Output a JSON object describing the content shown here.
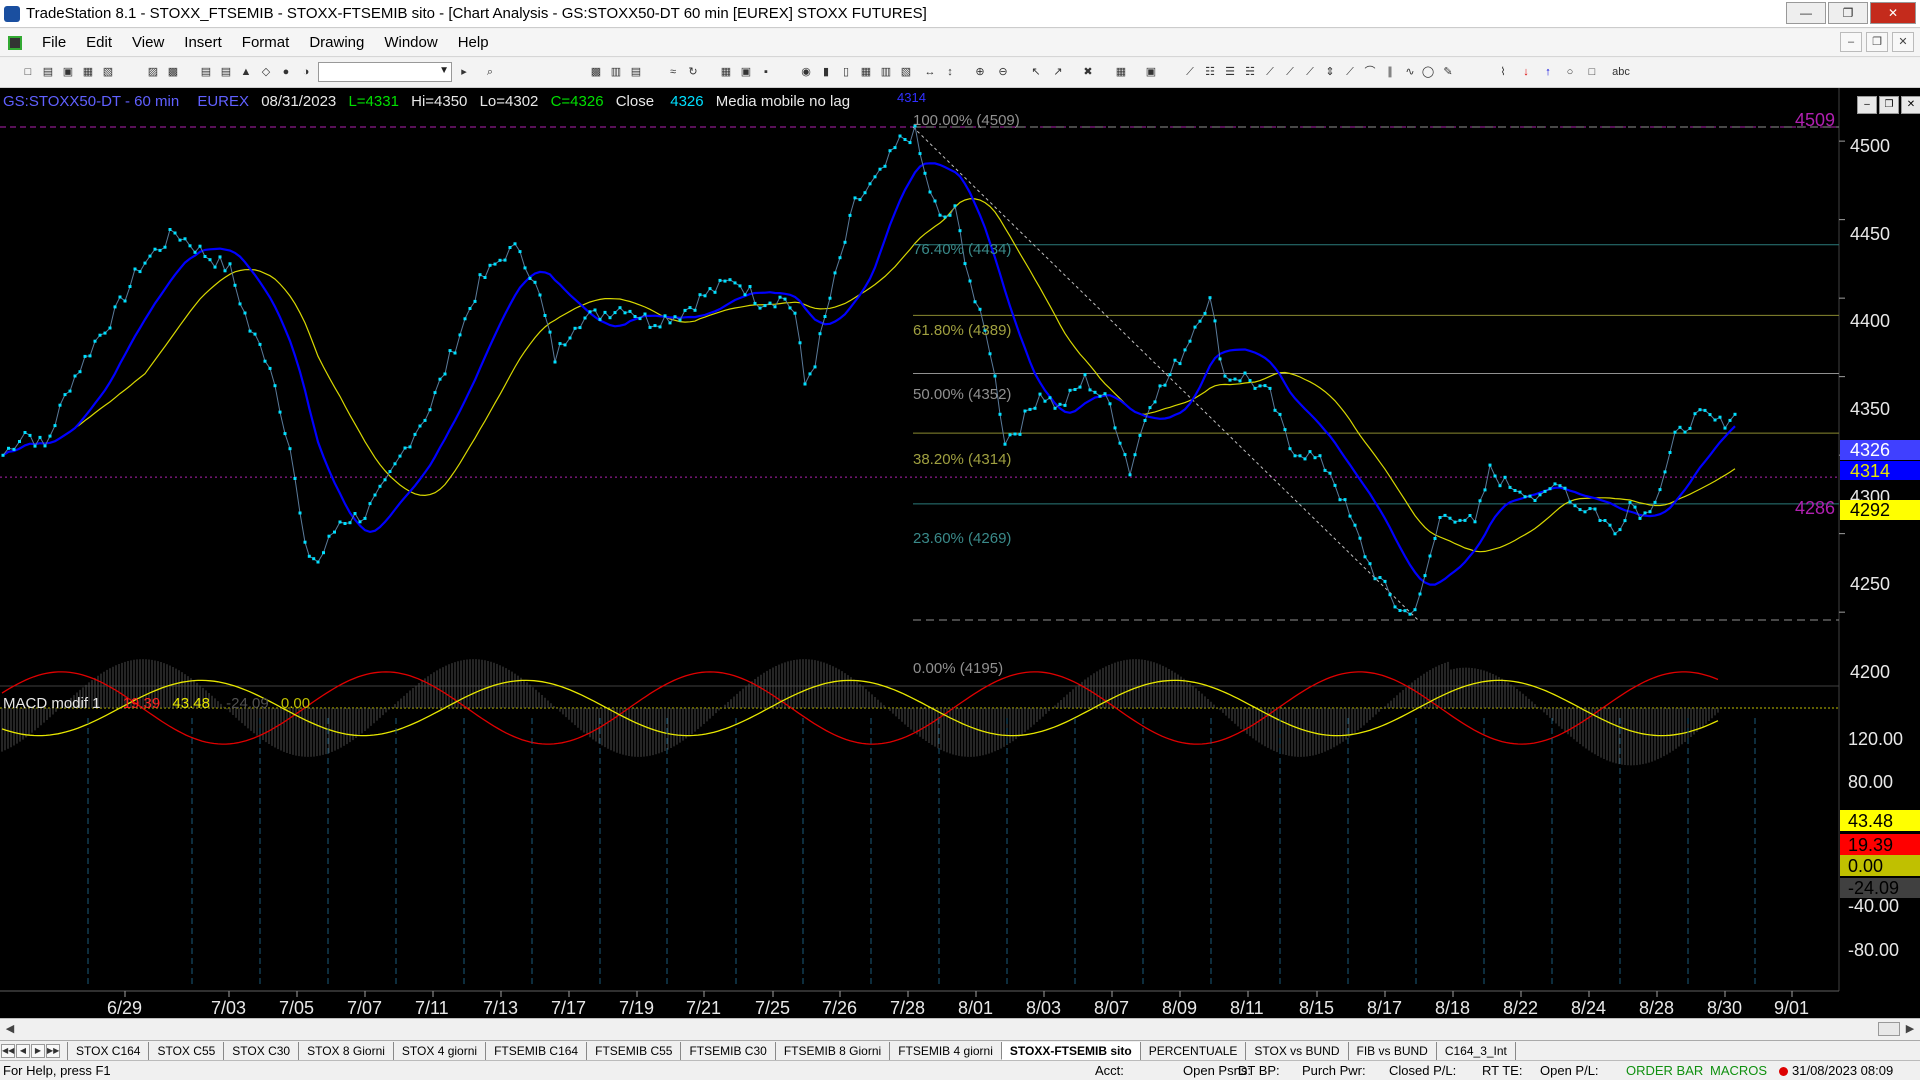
{
  "window": {
    "title": "TradeStation 8.1 - STOXX_FTSEMIB - STOXX-FTSEMIB sito - [Chart Analysis - GS:STOXX50-DT  60 min  [EUREX] STOXX FUTURES]"
  },
  "menu": [
    "File",
    "Edit",
    "View",
    "Insert",
    "Format",
    "Drawing",
    "Window",
    "Help"
  ],
  "chart": {
    "header": {
      "symbol": "GS:STOXX50-DT - 60 min",
      "exchange": "EUREX",
      "date": "08/31/2023",
      "last": "L=4331",
      "hi": "Hi=4350",
      "lo": "Lo=4302",
      "close": "C=4326",
      "close_label": "Close",
      "close_value": "4326",
      "indicator": "Media mobile no lag",
      "indicator_value": "4314"
    },
    "fib": {
      "f100": "100.00% (4509)",
      "f764": "76.40% (4434)",
      "f618": "61.80% (4389)",
      "f500": "50.00% (4352)",
      "f382": "38.20% (4314)",
      "f236": "23.60% (4269)",
      "f000": "0.00% (4195)"
    },
    "price_axis": [
      "4500",
      "4450",
      "4400",
      "4350",
      "4300",
      "4250",
      "4200"
    ],
    "price_tags": {
      "close": "4326",
      "ma": "4314",
      "yellow": "4292",
      "line_4509": "4509",
      "line_4286": "4286"
    },
    "date_axis": [
      "6/29",
      "7/03",
      "7/05",
      "7/07",
      "7/11",
      "7/13",
      "7/17",
      "7/19",
      "7/21",
      "7/25",
      "7/26",
      "7/28",
      "8/01",
      "8/03",
      "8/07",
      "8/09",
      "8/11",
      "8/15",
      "8/17",
      "8/18",
      "8/22",
      "8/24",
      "8/28",
      "8/30",
      "9/01"
    ],
    "macd": {
      "label": "MACD modif 1",
      "v1": "19.39",
      "v2": "43.48",
      "v3": "-24.09",
      "v4": "0.00",
      "axis": [
        "120.00",
        "80.00",
        "-40.00",
        "-80.00"
      ],
      "tags": {
        "yellow": "43.48",
        "red": "19.39",
        "zero": "0.00",
        "hist": "-24.09"
      }
    },
    "colors": {
      "price": "#00e0ff",
      "ma_blue": "#0000ff",
      "ma_yellow": "#d8d800",
      "macd_red": "#e00000",
      "macd_yellow": "#e8e800",
      "fib_line": "#9aa050"
    }
  },
  "tabs": [
    "STOX C164",
    "STOX C55",
    "STOX  C30",
    "STOX  8 Giorni",
    "STOX 4 giorni",
    "FTSEMIB C164",
    "FTSEMIB C55",
    "FTSEMIB C30",
    "FTSEMIB  8 Giorni",
    "FTSEMIB  4 giorni",
    "STOXX-FTSEMIB sito",
    "PERCENTUALE",
    "STOX vs BUND",
    "FIB vs BUND",
    "C164_3_Int"
  ],
  "active_tab": "STOXX-FTSEMIB sito",
  "status": {
    "help": "For Help, press F1",
    "acct": "Acct:",
    "open_psns": "Open Psns:",
    "dt_bp": "DT BP:",
    "purch_pwr": "Purch Pwr:",
    "closed_pl": "Closed P/L:",
    "rt_te": "RT TE:",
    "open_pl": "Open P/L:",
    "order_bar": "ORDER BAR",
    "macros": "MACROS",
    "datetime": "31/08/2023 08:09"
  }
}
